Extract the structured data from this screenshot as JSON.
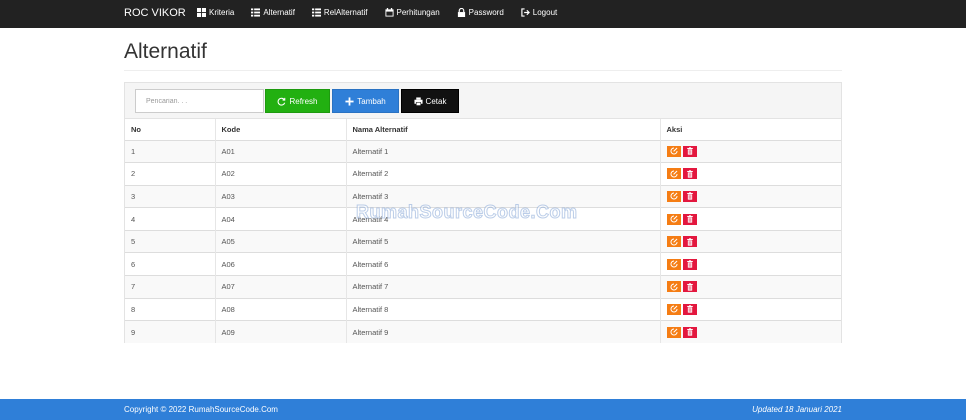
{
  "navbar": {
    "brand": "ROC VIKOR",
    "items": [
      {
        "label": "Kriteria",
        "icon": "grid-icon"
      },
      {
        "label": "Alternatif",
        "icon": "list-icon"
      },
      {
        "label": "RelAlternatif",
        "icon": "list-icon"
      },
      {
        "label": "Perhitungan",
        "icon": "calendar-icon"
      },
      {
        "label": "Password",
        "icon": "lock-icon"
      },
      {
        "label": "Logout",
        "icon": "logout-icon"
      }
    ]
  },
  "page": {
    "title": "Alternatif"
  },
  "toolbar": {
    "search_placeholder": "Pencarian. . .",
    "refresh_label": "Refresh",
    "tambah_label": "Tambah",
    "cetak_label": "Cetak"
  },
  "table": {
    "headers": [
      "No",
      "Kode",
      "Nama Alternatif",
      "Aksi"
    ],
    "rows": [
      {
        "no": "1",
        "kode": "A01",
        "nama": "Alternatif 1"
      },
      {
        "no": "2",
        "kode": "A02",
        "nama": "Alternatif 2"
      },
      {
        "no": "3",
        "kode": "A03",
        "nama": "Alternatif 3"
      },
      {
        "no": "4",
        "kode": "A04",
        "nama": "Alternatif 4"
      },
      {
        "no": "5",
        "kode": "A05",
        "nama": "Alternatif 5"
      },
      {
        "no": "6",
        "kode": "A06",
        "nama": "Alternatif 6"
      },
      {
        "no": "7",
        "kode": "A07",
        "nama": "Alternatif 7"
      },
      {
        "no": "8",
        "kode": "A08",
        "nama": "Alternatif 8"
      },
      {
        "no": "9",
        "kode": "A09",
        "nama": "Alternatif 9"
      }
    ]
  },
  "watermark": "RumahSourceCode.Com",
  "footer": {
    "copyright": "Copyright © 2022 RumahSourceCode.Com",
    "updated": "Updated 18 Januari 2021"
  },
  "colors": {
    "navbar": "#222222",
    "refresh": "#22b011",
    "tambah": "#2f7fd8",
    "cetak": "#111111",
    "edit": "#f57d14",
    "delete": "#e3173e",
    "footer": "#2f7fd8"
  }
}
